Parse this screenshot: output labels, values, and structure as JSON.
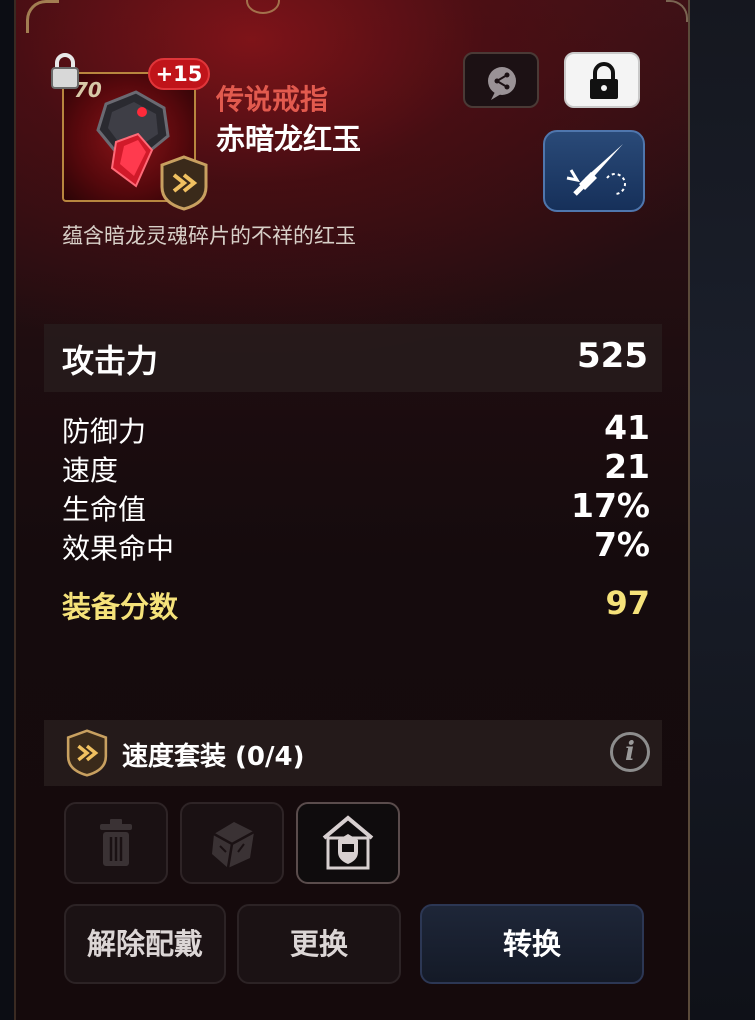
{
  "item": {
    "level": "70",
    "enhance": "+15",
    "rarity": "传说戒指",
    "name": "赤暗龙红玉",
    "description": "蕴含暗龙灵魂碎片的不祥的红玉"
  },
  "main_stat": {
    "label": "攻击力",
    "value": "525"
  },
  "sub_stats": [
    {
      "label": "防御力",
      "value": "41"
    },
    {
      "label": "速度",
      "value": "21"
    },
    {
      "label": "生命值",
      "value": "17%"
    },
    {
      "label": "效果命中",
      "value": "7%"
    }
  ],
  "score": {
    "label": "装备分数",
    "value": "97"
  },
  "set": {
    "label": "速度套装 (0/4)",
    "info": "i"
  },
  "buttons": {
    "unequip": "解除配戴",
    "change": "更换",
    "convert": "转换"
  },
  "colors": {
    "rarity": "#e25a4e",
    "score": "#f5e27a",
    "enhance_badge": "#c0141a"
  },
  "icons": [
    "lock-icon",
    "share-icon",
    "padlock-icon",
    "skill-sword-icon",
    "speed-set-icon",
    "info-icon",
    "trash-icon",
    "cube-icon",
    "shield-house-icon"
  ]
}
